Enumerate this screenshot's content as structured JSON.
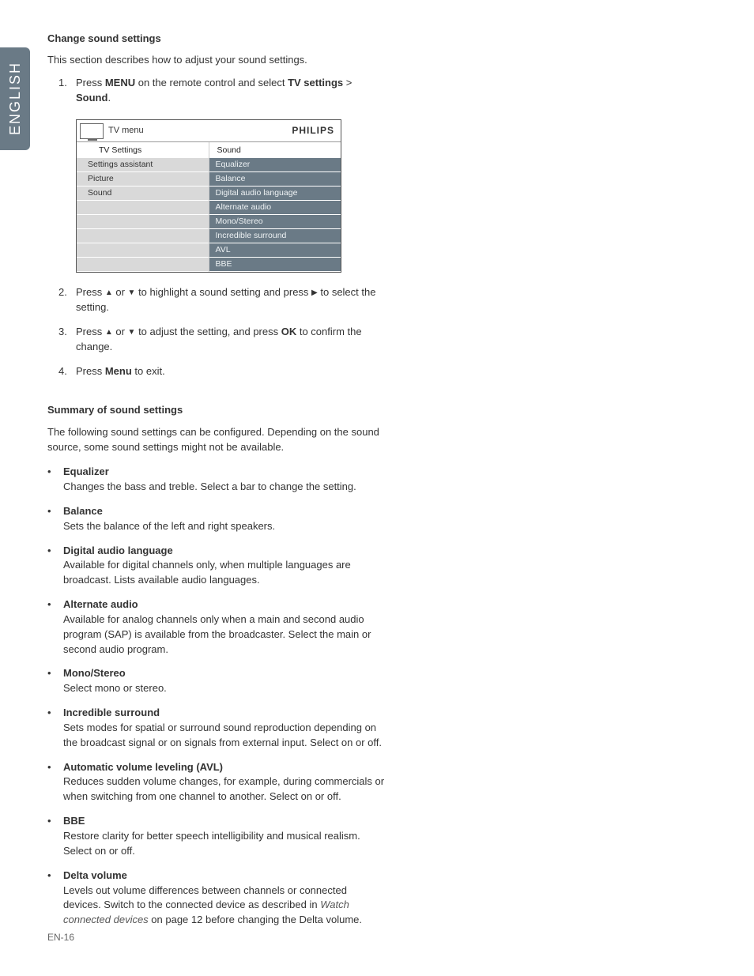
{
  "sidebar": {
    "language": "ENGLISH"
  },
  "section": {
    "title": "Change sound settings",
    "intro": "This section describes how to adjust your sound settings."
  },
  "steps": [
    {
      "num": "1.",
      "pre": "Press ",
      "b1": "MENU",
      "mid": " on the remote control and select ",
      "b2": "TV settings",
      "post": " > ",
      "b3": "Sound",
      "end": "."
    },
    {
      "num": "2.",
      "pre": "Press ",
      "sym1": "▲",
      "mid1": " or ",
      "sym2": "▼",
      "mid2": " to highlight a sound setting and press ",
      "sym3": "▶",
      "post": " to select the setting."
    },
    {
      "num": "3.",
      "pre": "Press ",
      "sym1": "▲",
      "mid1": " or ",
      "sym2": "▼",
      "mid2": " to adjust the setting, and press ",
      "b1": "OK",
      "post": " to confirm the change."
    },
    {
      "num": "4.",
      "pre": "Press ",
      "b1": "Menu",
      "post": " to exit."
    }
  ],
  "menu": {
    "title": "TV menu",
    "brand": "PHILIPS",
    "left_header": "TV Settings",
    "right_header": "Sound",
    "left_items": [
      "Settings assistant",
      "Picture",
      "Sound",
      "",
      "",
      "",
      "",
      ""
    ],
    "right_items": [
      "Equalizer",
      "Balance",
      "Digital audio language",
      "Alternate audio",
      "Mono/Stereo",
      "Incredible surround",
      "AVL",
      "BBE"
    ]
  },
  "summary": {
    "heading": "Summary of sound settings",
    "intro": "The following sound settings can be configured. Depending on the sound source, some sound settings might not be available."
  },
  "settings": [
    {
      "name": "Equalizer",
      "desc": "Changes the bass and treble.  Select a bar to change the setting."
    },
    {
      "name": "Balance",
      "desc": "Sets the balance of the left and right speakers."
    },
    {
      "name": "Digital audio language",
      "desc": "Available for digital channels only, when multiple languages are broadcast. Lists available audio languages."
    },
    {
      "name": "Alternate audio",
      "desc": "Available for analog channels only when a main and second audio program (SAP) is available from the broadcaster. Select the main or second audio program."
    },
    {
      "name": "Mono/Stereo",
      "desc": "Select mono or stereo."
    },
    {
      "name": "Incredible surround",
      "desc": "Sets modes for spatial or surround sound reproduction depending on the broadcast signal or on signals from external input.  Select on or off."
    },
    {
      "name": "Automatic volume leveling (AVL)",
      "desc": "Reduces sudden volume changes, for example, during commercials or when switching from one channel to another. Select on or off."
    },
    {
      "name": "BBE",
      "desc": "Restore clarity for better speech intelligibility and musical realism. Select on or off."
    },
    {
      "name": "Delta volume",
      "desc_pre": "Levels out volume differences between channels or connected devices.  Switch to the connected device as described in ",
      "desc_italic": "Watch connected devices",
      "desc_post": " on page 12 before changing the Delta volume."
    }
  ],
  "page_number": "EN-16"
}
